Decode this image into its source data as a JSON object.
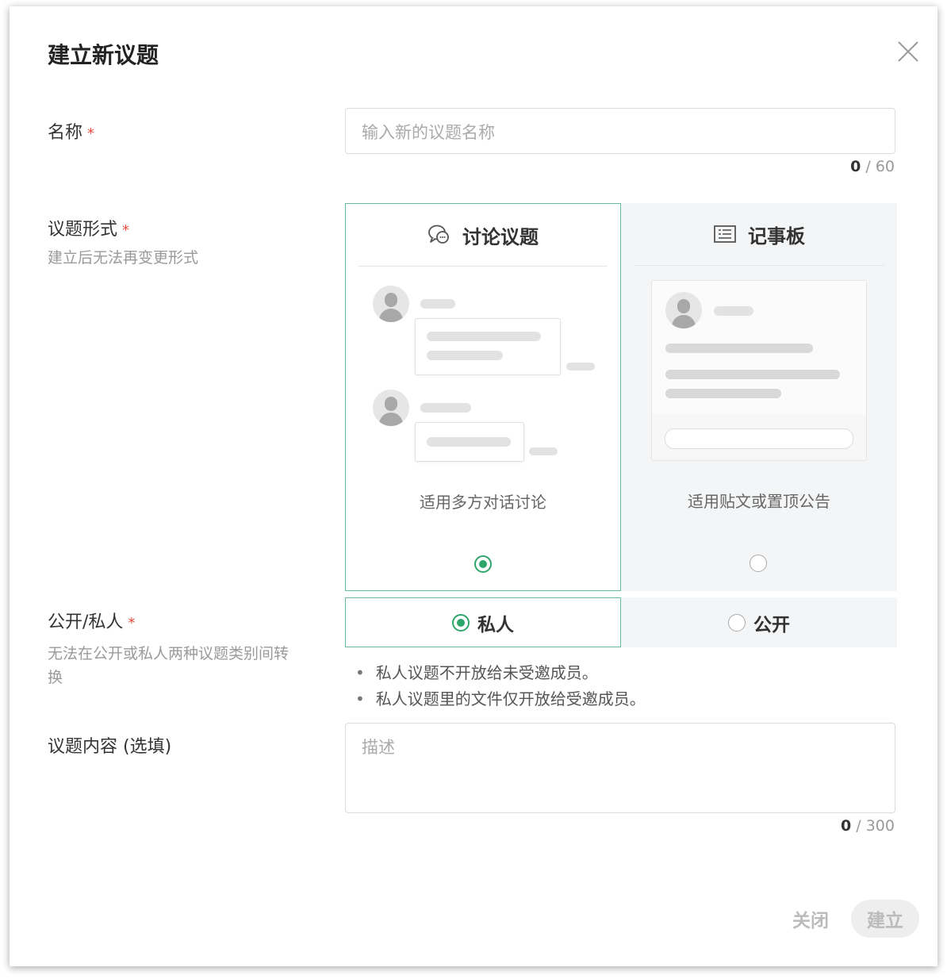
{
  "dialog": {
    "title": "建立新议题"
  },
  "name_field": {
    "label": "名称",
    "required_mark": "*",
    "placeholder": "输入新的议题名称",
    "count": "0",
    "max": "/ 60"
  },
  "format_field": {
    "label": "议题形式",
    "required_mark": "*",
    "hint": "建立后无法再变更形式",
    "options": [
      {
        "title": "讨论议题",
        "description": "适用多方对话讨论",
        "selected": true,
        "icon": "chat-bubbles-icon"
      },
      {
        "title": "记事板",
        "description": "适用贴文或置顶公告",
        "selected": false,
        "icon": "board-icon"
      }
    ]
  },
  "privacy_field": {
    "label": "公开/私人",
    "required_mark": "*",
    "hint": "无法在公开或私人两种议题类别间转换",
    "options": [
      {
        "label": "私人",
        "selected": true
      },
      {
        "label": "公开",
        "selected": false
      }
    ],
    "notes": [
      "私人议题不开放给未受邀成员。",
      "私人议题里的文件仅开放给受邀成员。"
    ]
  },
  "content_field": {
    "label": "议题内容 (选填)",
    "placeholder": "描述",
    "count": "0",
    "max": "/ 300"
  },
  "footer": {
    "close_label": "关闭",
    "create_label": "建立"
  },
  "colors": {
    "accent": "#2ea66b",
    "selected_border": "#6ab7a2",
    "required": "#e74c3c"
  }
}
